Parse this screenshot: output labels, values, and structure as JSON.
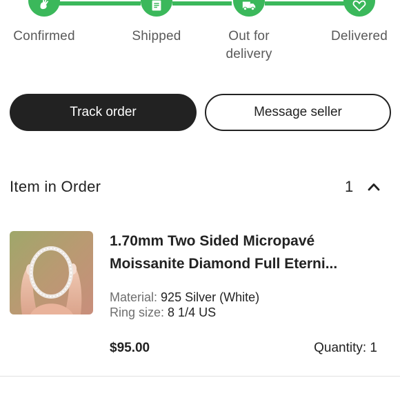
{
  "colors": {
    "progress_green": "#3bb85b",
    "primary_dark": "#222222",
    "muted_text": "#6e6e6e"
  },
  "progress": {
    "steps": [
      {
        "label_line1": "Confirmed",
        "label_line2": "",
        "icon": "hand-wave-icon"
      },
      {
        "label_line1": "Shipped",
        "label_line2": "",
        "icon": "package-icon"
      },
      {
        "label_line1": "Out for",
        "label_line2": "delivery",
        "icon": "delivery-truck-icon"
      },
      {
        "label_line1": "Delivered",
        "label_line2": "",
        "icon": "heart-icon"
      }
    ]
  },
  "actions": {
    "track_label": "Track order",
    "message_label": "Message seller"
  },
  "order_items": {
    "title": "Item in Order",
    "count": "1",
    "toggle_icon": "chevron-up-icon"
  },
  "item": {
    "title_line1": "1.70mm Two Sided Micropavé",
    "title_line2": "Moissanite Diamond Full Eterni...",
    "attributes": [
      {
        "key": "Material:",
        "value": "925 Silver (White)"
      },
      {
        "key": "Ring size:",
        "value": "8 1/4 US"
      }
    ],
    "price": "$95.00",
    "quantity": "Quantity: 1",
    "thumbnail_icon": "ring-photo"
  }
}
